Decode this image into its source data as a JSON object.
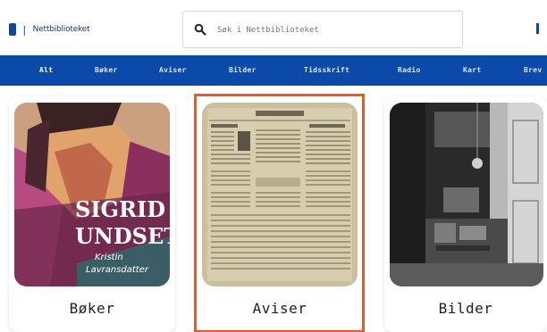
{
  "header": {
    "brand": "Nettbiblioteket",
    "search_placeholder": "Søk i Nettbiblioteket"
  },
  "nav": {
    "items": [
      "Alt",
      "Bøker",
      "Aviser",
      "Bilder",
      "Tidsskrift",
      "Radio",
      "Kart",
      "Brev"
    ],
    "active": "Alt"
  },
  "cards": [
    {
      "label": "Bøker",
      "cover_text": [
        "SIGRID",
        "UNDSET",
        "Kristin",
        "Lavransdatter"
      ]
    },
    {
      "label": "Aviser",
      "selected": true
    },
    {
      "label": "Bilder"
    }
  ],
  "colors": {
    "nav_background": "#0b4aa8",
    "selection_border": "#e8582e"
  }
}
